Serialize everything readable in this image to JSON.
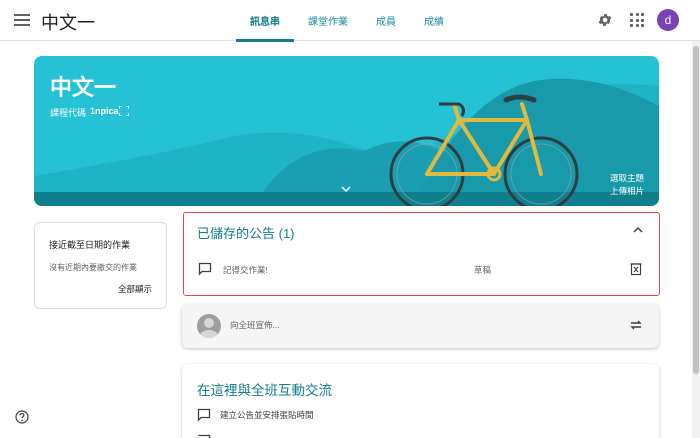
{
  "header": {
    "title": "中文一",
    "tabs": [
      {
        "label": "訊息串",
        "active": true
      },
      {
        "label": "課堂作業",
        "active": false
      },
      {
        "label": "成員",
        "active": false
      },
      {
        "label": "成績",
        "active": false
      }
    ],
    "avatar_letter": "d",
    "accent_color": "#137d8a",
    "avatar_color": "#7b3fb8"
  },
  "banner": {
    "title": "中文一",
    "class_code_label": "課程代碼",
    "class_code": "1npica",
    "select_theme": "選取主題",
    "upload_photo": "上傳相片",
    "color": "#25c2d6"
  },
  "upcoming": {
    "title": "接近截至日期的作業",
    "empty": "沒有近期內要繳交的作業",
    "view_all": "全部顯示"
  },
  "saved": {
    "title": "已儲存的公告 (1)",
    "items": [
      {
        "text": "記得交作業!",
        "status": "草稿"
      }
    ]
  },
  "share": {
    "placeholder": "向全班宣佈..."
  },
  "interact": {
    "title": "在這裡與全班互動交流",
    "items": [
      {
        "text": "建立公告並安排張貼時間"
      }
    ]
  },
  "icons": [
    "menu-icon",
    "gear-icon",
    "apps-icon",
    "expand-icon",
    "chevron-down-icon",
    "chevron-up-icon",
    "comment-icon",
    "delete-icon",
    "repost-icon",
    "help-icon"
  ]
}
